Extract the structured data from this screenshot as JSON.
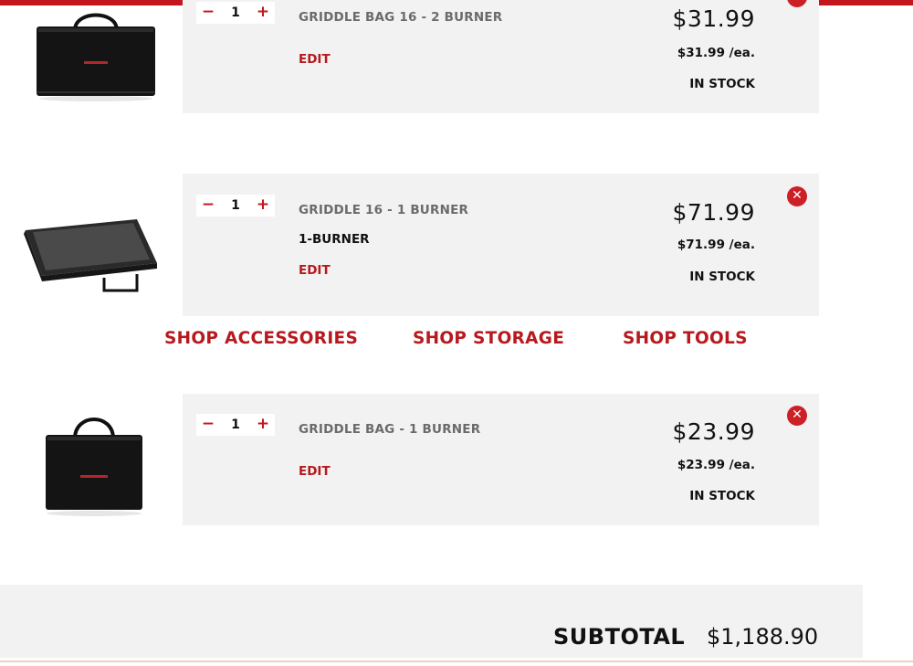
{
  "cart": {
    "items": [
      {
        "name": "GRIDDLE BAG 16 - 2 BURNER",
        "quantity": "1",
        "edit_label": "EDIT",
        "price": "$31.99",
        "unit_price": "$31.99 /ea.",
        "stock": "IN STOCK",
        "thumbnail": "griddle-bag-image"
      },
      {
        "name": "GRIDDLE 16 - 1 BURNER",
        "variant": "1-BURNER",
        "quantity": "1",
        "edit_label": "EDIT",
        "price": "$71.99",
        "unit_price": "$71.99 /ea.",
        "stock": "IN STOCK",
        "thumbnail": "griddle-image"
      },
      {
        "name": "GRIDDLE BAG - 1 BURNER",
        "quantity": "1",
        "edit_label": "EDIT",
        "price": "$23.99",
        "unit_price": "$23.99 /ea.",
        "stock": "IN STOCK",
        "thumbnail": "griddle-bag-image"
      }
    ],
    "controls": {
      "minus": "−",
      "plus": "+",
      "remove": "✕"
    }
  },
  "shop_links": {
    "accessories": "SHOP ACCESSORIES",
    "storage": "SHOP STORAGE",
    "tools": "SHOP TOOLS"
  },
  "summary": {
    "subtotal_label": "SUBTOTAL",
    "subtotal_value": "$1,188.90"
  },
  "colors": {
    "brand_red": "#c4161c",
    "card_bg": "#f2f2f2",
    "text_dark": "#111111",
    "text_grey": "#6b6b6b"
  }
}
